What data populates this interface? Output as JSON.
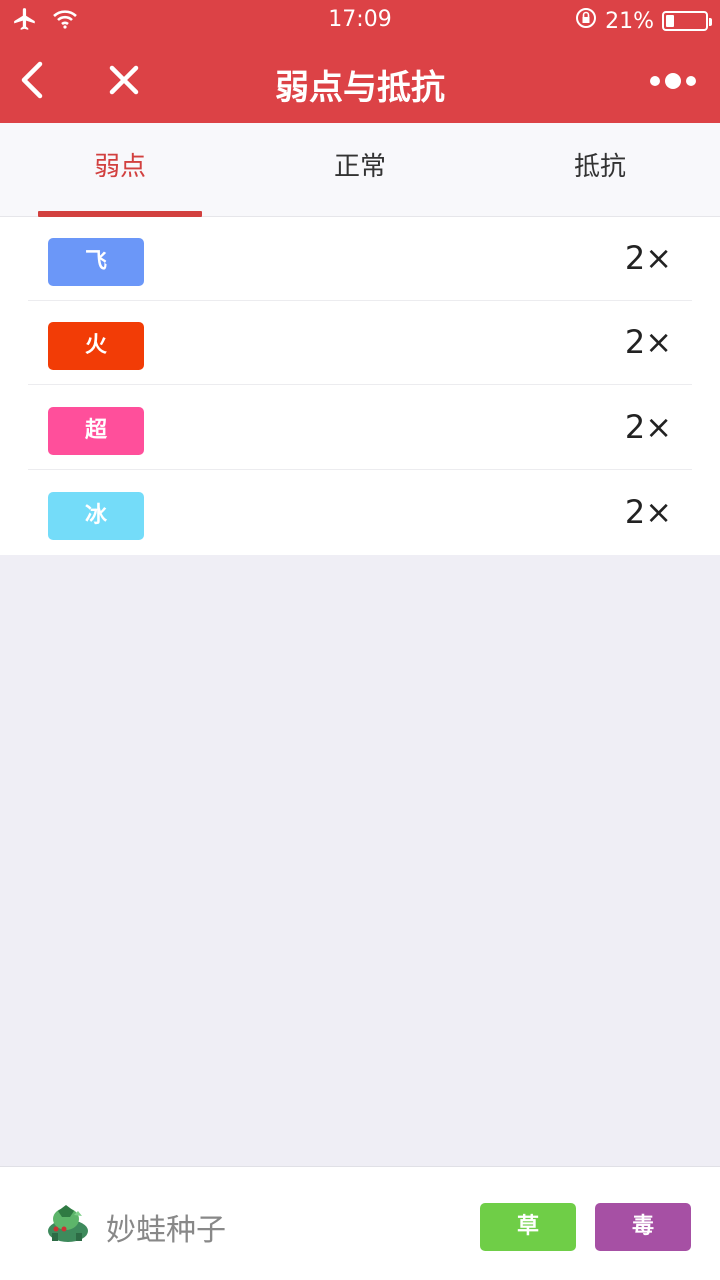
{
  "status_bar": {
    "time": "17:09",
    "battery": "21%",
    "battery_level": 0.21,
    "icons": [
      "airplane-icon",
      "wifi-icon",
      "rotation-lock-icon",
      "battery-icon"
    ]
  },
  "nav": {
    "title": "弱点与抵抗",
    "back_icon": "chevron-left-icon",
    "close_icon": "close-icon",
    "more_icon": "more-dots-icon"
  },
  "tabs": [
    {
      "label": "弱点",
      "active": true
    },
    {
      "label": "正常",
      "active": false
    },
    {
      "label": "抵抗",
      "active": false
    }
  ],
  "weaknesses": [
    {
      "type": "飞",
      "color": "#6b97f8",
      "multiplier": "2×"
    },
    {
      "type": "火",
      "color": "#f23c06",
      "multiplier": "2×"
    },
    {
      "type": "超",
      "color": "#ff4f9b",
      "multiplier": "2×"
    },
    {
      "type": "冰",
      "color": "#74dcf9",
      "multiplier": "2×"
    }
  ],
  "pokemon": {
    "name": "妙蛙种子",
    "types": [
      {
        "label": "草",
        "color": "#6fce47"
      },
      {
        "label": "毒",
        "color": "#a650a4"
      }
    ]
  },
  "colors": {
    "accent": "#dc4246",
    "tab_active": "#d2403f"
  }
}
